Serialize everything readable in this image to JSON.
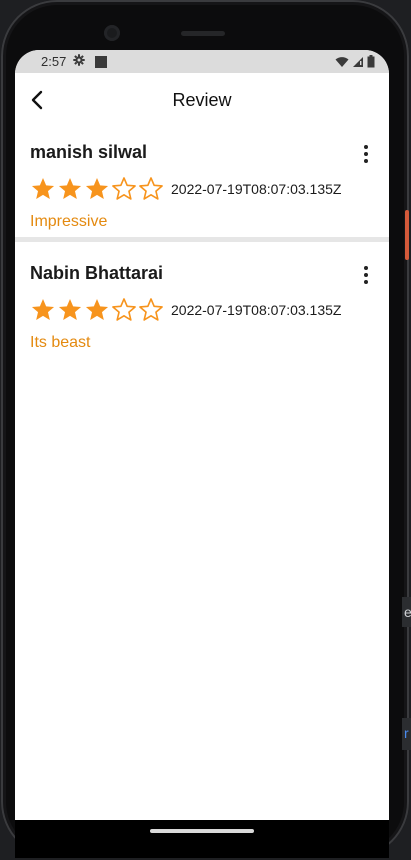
{
  "status_bar": {
    "time": "2:57",
    "icons": [
      "gear-icon",
      "square-notification-icon",
      "wifi-icon",
      "signal-icon",
      "battery-icon"
    ]
  },
  "app_bar": {
    "title": "Review",
    "back_icon": "arrow-back-icon"
  },
  "reviews": [
    {
      "name": "manish silwal",
      "rating": 3,
      "max_rating": 5,
      "date": "2022-07-19T08:07:03.135Z",
      "text": "Impressive"
    },
    {
      "name": "Nabin Bhattarai",
      "rating": 3,
      "max_rating": 5,
      "date": "2022-07-19T08:07:03.135Z",
      "text": "Its beast"
    }
  ],
  "colors": {
    "star": "#f7941d",
    "review_text": "#e48a10",
    "status_bar": "#dcdcdc",
    "divider": "#e6e6e6"
  },
  "ide_fragments": {
    "a": "e",
    "b": "r"
  }
}
